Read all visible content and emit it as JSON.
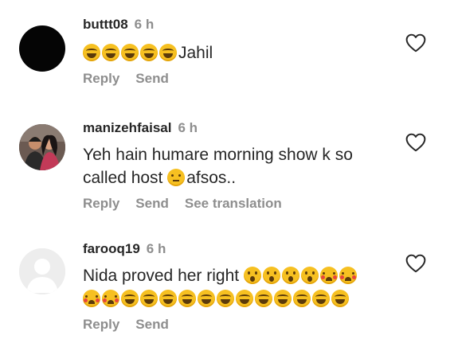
{
  "comments": [
    {
      "username": "buttt08",
      "time": "6 h",
      "text_end": "Jahil",
      "reply_label": "Reply",
      "send_label": "Send",
      "avatar": "black-circle"
    },
    {
      "username": "manizehfaisal",
      "time": "6 h",
      "text_line1": "Yeh hain humare morning show k so",
      "text_line2a": "called host ",
      "text_line2b": "afsos..",
      "reply_label": "Reply",
      "send_label": "Send",
      "translate_label": "See translation",
      "avatar": "couple-photo"
    },
    {
      "username": "farooq19",
      "time": "6 h",
      "text_start": "Nida proved her right ",
      "reply_label": "Reply",
      "send_label": "Send",
      "avatar": "default-avatar"
    }
  ],
  "icons": {
    "like": "heart-outline-icon"
  },
  "colors": {
    "text": "#262626",
    "muted": "#8e8e8e",
    "emoji": "#f6c021"
  }
}
